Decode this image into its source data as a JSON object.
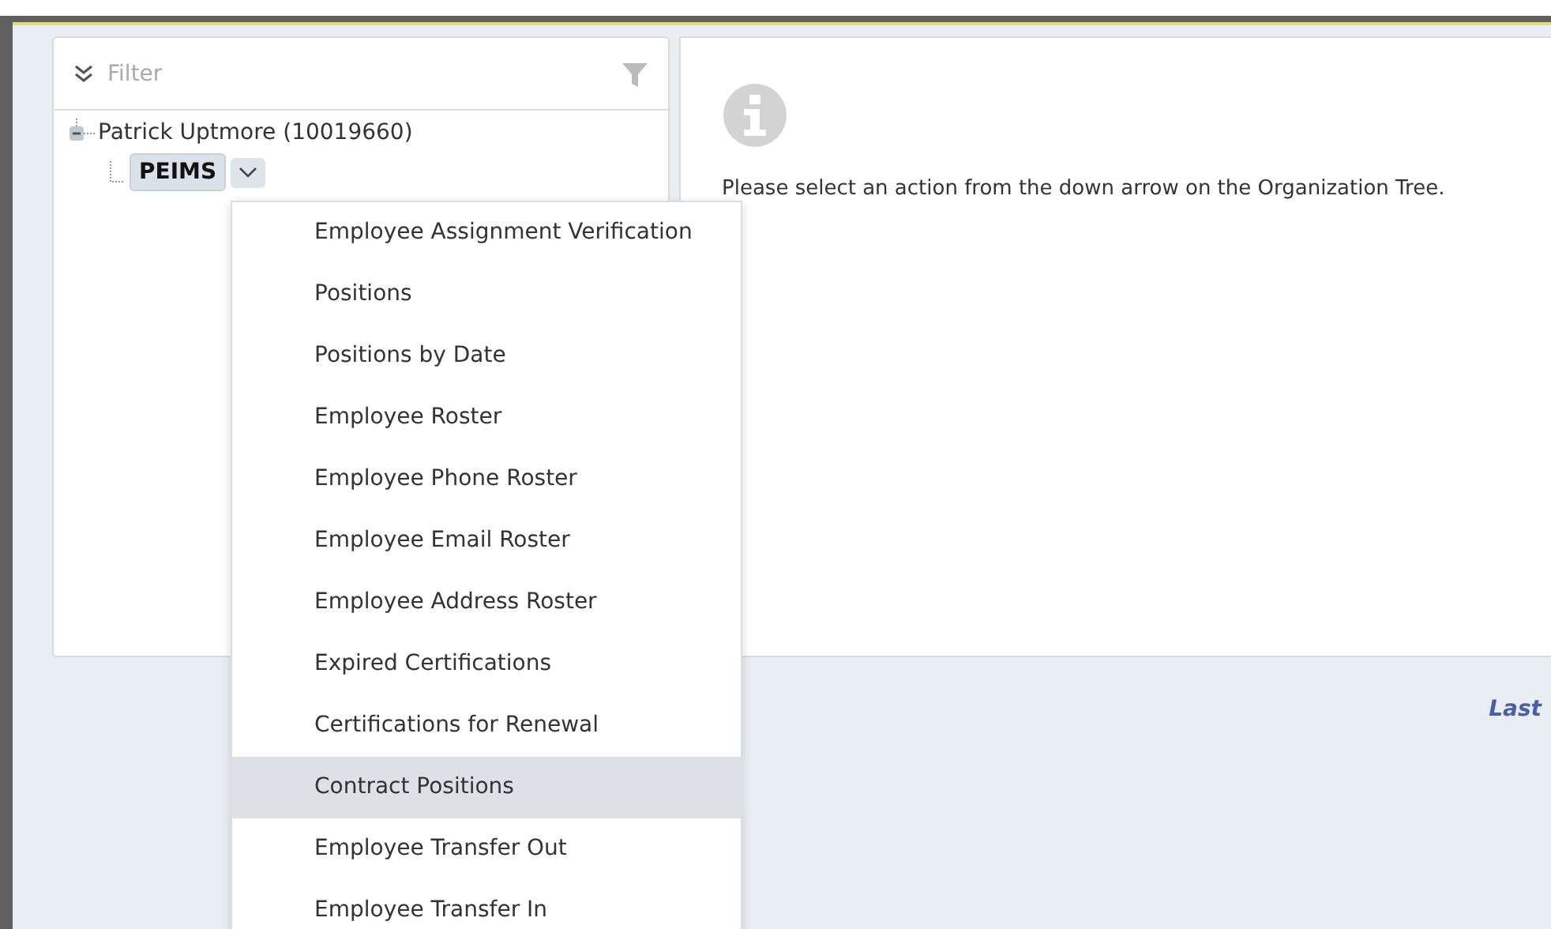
{
  "filter": {
    "placeholder": "Filter"
  },
  "tree": [
    {
      "label": "Patrick Uptmore (10019660)",
      "expanded": true,
      "children": [
        {
          "label": "PEIMS",
          "selected": true
        }
      ]
    }
  ],
  "message": "Please select an action from the down arrow on the Organization Tree.",
  "menu": [
    {
      "label": "Employee Assignment Verification",
      "selected": false
    },
    {
      "label": "Positions",
      "selected": false
    },
    {
      "label": "Positions by Date",
      "selected": false
    },
    {
      "label": "Employee Roster",
      "selected": false
    },
    {
      "label": "Employee Phone Roster",
      "selected": false
    },
    {
      "label": "Employee Email Roster",
      "selected": false
    },
    {
      "label": "Employee Address Roster",
      "selected": false
    },
    {
      "label": "Expired Certifications",
      "selected": false
    },
    {
      "label": "Certifications for Renewal",
      "selected": false
    },
    {
      "label": "Contract Positions",
      "selected": true
    },
    {
      "label": "Employee Transfer Out",
      "selected": false
    },
    {
      "label": "Employee Transfer In",
      "selected": false
    }
  ],
  "footer_link": "Last"
}
